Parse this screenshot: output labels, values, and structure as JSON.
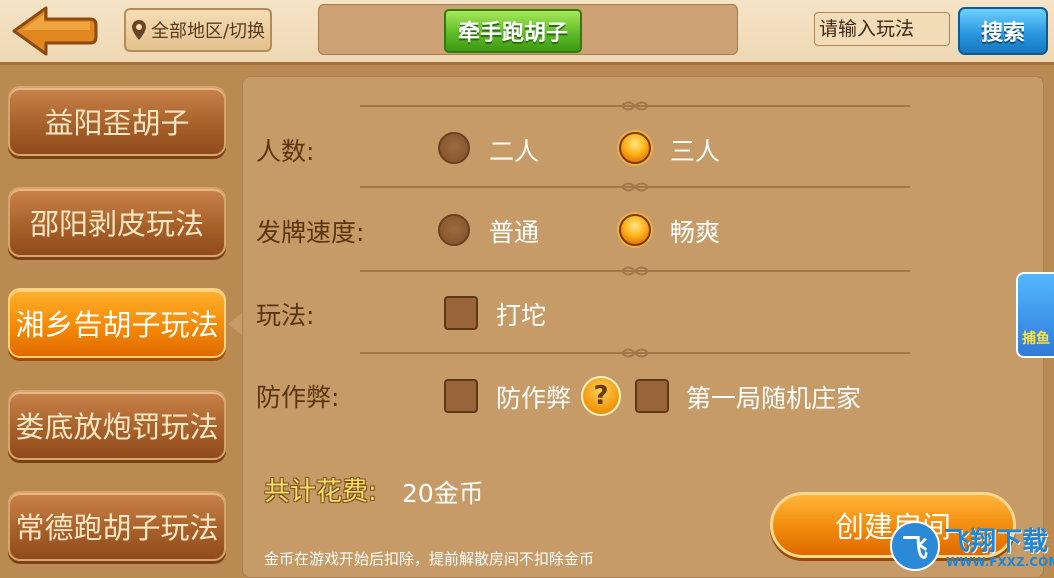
{
  "header": {
    "region_label": "全部地区/切换",
    "game_title": "牵手跑胡子",
    "search_placeholder": "请输入玩法",
    "search_label": "搜索"
  },
  "sidebar": {
    "items": [
      {
        "label": "益阳歪胡子",
        "active": false
      },
      {
        "label": "邵阳剥皮玩法",
        "active": false
      },
      {
        "label": "湘乡告胡子玩法",
        "active": true
      },
      {
        "label": "娄底放炮罚玩法",
        "active": false
      },
      {
        "label": "常德跑胡子玩法",
        "active": false
      }
    ]
  },
  "settings": {
    "players": {
      "label": "人数:",
      "options": [
        "二人",
        "三人"
      ],
      "selected": "三人"
    },
    "speed": {
      "label": "发牌速度:",
      "options": [
        "普通",
        "畅爽"
      ],
      "selected": "畅爽"
    },
    "rules": {
      "label": "玩法:",
      "options": [
        {
          "label": "打坨",
          "checked": false
        }
      ]
    },
    "anticheat": {
      "label": "防作弊:",
      "options": [
        {
          "label": "防作弊",
          "checked": false
        },
        {
          "label": "第一局随机庄家",
          "checked": false
        }
      ],
      "help_symbol": "?"
    }
  },
  "cost": {
    "label": "共计花费:",
    "value": "20金币"
  },
  "note": "金币在游戏开始后扣除，提前解散房间不扣除金币",
  "create_button": "创建房间",
  "side_widget": "捕鱼",
  "watermark": {
    "symbol": "飞",
    "title": "飞翔下载",
    "url": "WWW.FXXZ.COM"
  },
  "colors": {
    "panel": "#c79b68",
    "accent_orange": "#f58a06",
    "title_green": "#5fbb26",
    "search_blue": "#2a98e0",
    "label_brown": "#5a3510"
  }
}
